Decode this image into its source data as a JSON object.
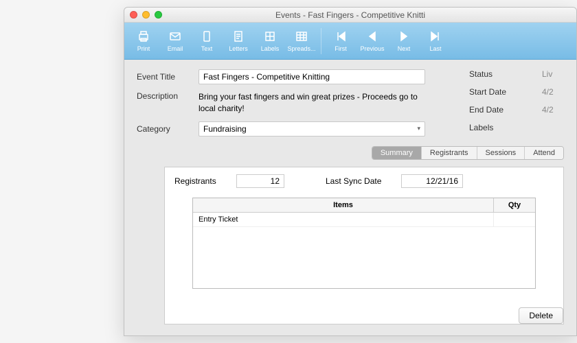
{
  "window": {
    "title": "Events - Fast Fingers - Competitive Knitti"
  },
  "toolbar": {
    "print": "Print",
    "email": "Email",
    "text": "Text",
    "letters": "Letters",
    "labels": "Labels",
    "spreads": "Spreads...",
    "first": "First",
    "previous": "Previous",
    "next": "Next",
    "last": "Last"
  },
  "form": {
    "event_title_label": "Event Title",
    "event_title": "Fast Fingers - Competitive Knitting",
    "description_label": "Description",
    "description": "Bring your fast fingers and win great prizes - Proceeds go to local charity!",
    "category_label": "Category",
    "category": "Fundraising",
    "status_label": "Status",
    "status_value": "Liv",
    "start_date_label": "Start Date",
    "start_date_value": "4/2",
    "end_date_label": "End Date",
    "end_date_value": "4/2",
    "labels_label": "Labels"
  },
  "tabs": {
    "summary": "Summary",
    "registrants": "Registrants",
    "sessions": "Sessions",
    "attend": "Attend"
  },
  "summary": {
    "registrants_label": "Registrants",
    "registrants_count": "12",
    "last_sync_label": "Last Sync Date",
    "last_sync_value": "12/21/16",
    "items_header": "Items",
    "qty_header": "Qty",
    "rows": [
      {
        "item": "Entry Ticket",
        "qty": ""
      }
    ]
  },
  "buttons": {
    "delete": "Delete"
  }
}
